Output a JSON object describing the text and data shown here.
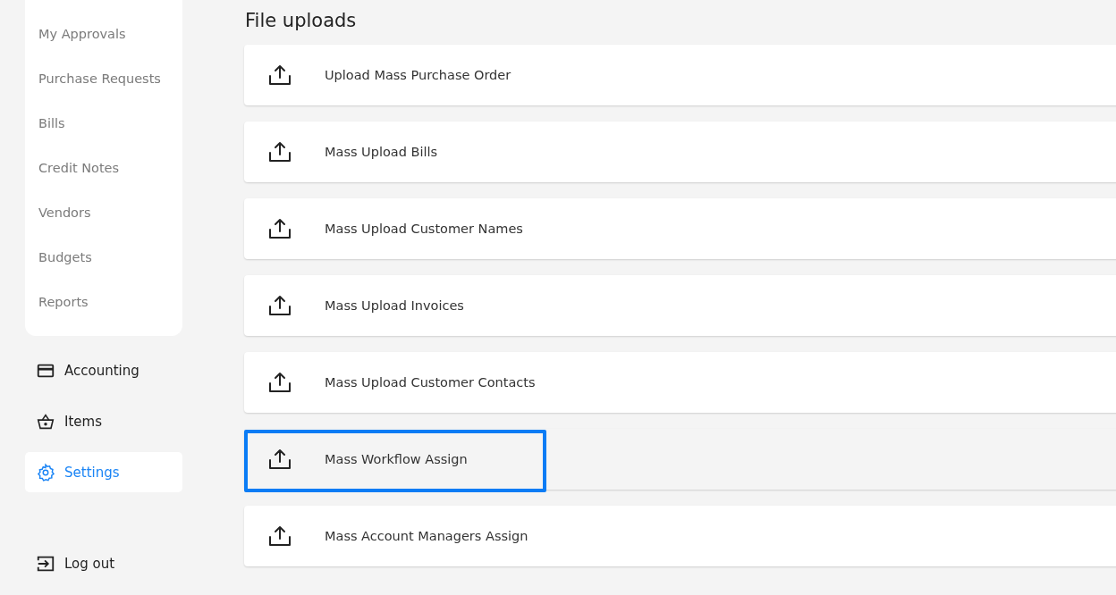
{
  "sidebar": {
    "sub_items": [
      "My Approvals",
      "Purchase Requests",
      "Bills",
      "Credit Notes",
      "Vendors",
      "Budgets",
      "Reports"
    ],
    "nav_items": [
      {
        "label": "Accounting",
        "kind": "card",
        "selected": false
      },
      {
        "label": "Items",
        "kind": "basket",
        "selected": false
      },
      {
        "label": "Settings",
        "kind": "gear",
        "selected": true
      }
    ],
    "logout": "Log out"
  },
  "main": {
    "title": "File uploads",
    "rows": [
      {
        "label": "Upload Mass Purchase Order",
        "highlighted": false
      },
      {
        "label": "Mass Upload Bills",
        "highlighted": false
      },
      {
        "label": "Mass Upload Customer Names",
        "highlighted": false
      },
      {
        "label": "Mass Upload Invoices",
        "highlighted": false
      },
      {
        "label": "Mass Upload Customer Contacts",
        "highlighted": false
      },
      {
        "label": "Mass Workflow Assign",
        "highlighted": true
      },
      {
        "label": "Mass Account Managers Assign",
        "highlighted": false
      }
    ]
  }
}
